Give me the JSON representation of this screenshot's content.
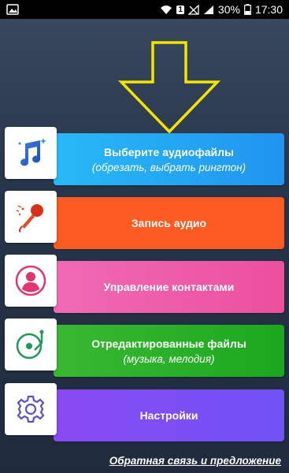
{
  "status_bar": {
    "battery": "30%",
    "time": "17:30",
    "sim_badge": "1"
  },
  "menu": {
    "items": [
      {
        "title": "Выберите аудиофайлы",
        "subtitle": "(обрезать, выбрать рингтон)",
        "icon": "music-note-icon",
        "color": "#2aa7f3"
      },
      {
        "title": "Запись аудио",
        "subtitle": "",
        "icon": "microphone-icon",
        "color": "#fb5a22"
      },
      {
        "title": "Управление контактами",
        "subtitle": "",
        "icon": "contact-avatar-icon",
        "color": "#f05ca9"
      },
      {
        "title": "Отредактированные файлы",
        "subtitle": "(музыка, мелодия)",
        "icon": "turntable-icon",
        "color": "#22ad27"
      },
      {
        "title": "Настройки",
        "subtitle": "",
        "icon": "gear-icon",
        "color": "#7a4cf7"
      }
    ]
  },
  "footer": {
    "feedback_label": "Обратная связь и предложение"
  },
  "colors": {
    "arrow": "#f4e400",
    "background": "#27354a"
  }
}
